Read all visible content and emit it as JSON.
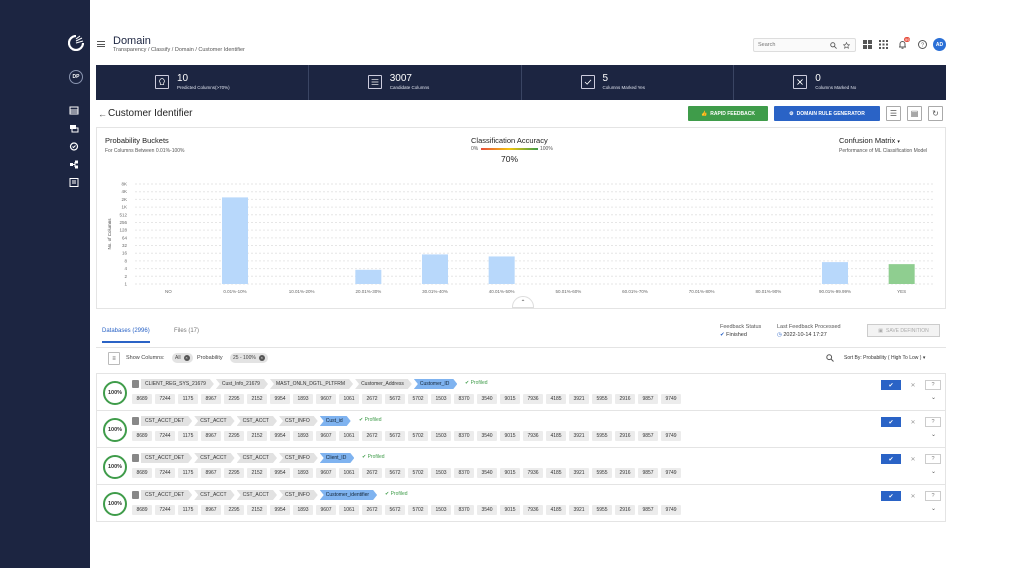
{
  "header": {
    "title": "Domain",
    "breadcrumb": "Transparency  /  Classify  /  Domain  /  Customer Identifier",
    "search_placeholder": "Search",
    "notification_count": "99",
    "avatar": "AD"
  },
  "sidebar": {
    "badge": "DP"
  },
  "stats": [
    {
      "value": "10",
      "label": "Predicted Columns(>70%)",
      "icon": "bulb-icon"
    },
    {
      "value": "3007",
      "label": "Candidate Columns",
      "icon": "table-icon"
    },
    {
      "value": "5",
      "label": "Columns Marked Yes",
      "icon": "check-icon"
    },
    {
      "value": "0",
      "label": "Columns Marked No",
      "icon": "close-icon"
    }
  ],
  "page": {
    "title": "Customer Identifier",
    "rapid_feedback": "RAPID FEEDBACK",
    "rule_generator": "DOMAIN RULE GENERATOR"
  },
  "panel": {
    "prob_title": "Probability Buckets",
    "prob_sub": "For Columns Between 0.01%-100%",
    "acc_title": "Classification Accuracy",
    "acc_min": "0%",
    "acc_max": "100%",
    "acc_value": "70%",
    "cm_title": "Confusion Matrix",
    "cm_sub": "Performance of ML Classification Model"
  },
  "chart_data": {
    "type": "bar",
    "ylabel": "No. of Columns",
    "yticks": [
      "8K",
      "4K",
      "2K",
      "1K",
      "512",
      "256",
      "128",
      "64",
      "32",
      "16",
      "8",
      "4",
      "2",
      "1"
    ],
    "categories": [
      "NO",
      "0.01%-10%",
      "10.01%-20%",
      "20.01%-30%",
      "30.01%-40%",
      "40.01%-50%",
      "50.01%-60%",
      "60.01%-70%",
      "70.01%-80%",
      "80.01%-90%",
      "90.01%-99.99%",
      "YES"
    ],
    "values": [
      0,
      2048,
      0,
      3,
      12,
      10,
      0,
      0,
      0,
      0,
      6,
      5
    ],
    "log_scale": true,
    "colors": {
      "bar": "#b8d8fb",
      "yes": "#8fce90"
    },
    "grid": true
  },
  "tabs": [
    {
      "label": "Databases (2996)"
    },
    {
      "label": "Files (17)"
    }
  ],
  "feedback": {
    "status_label": "Feedback Status",
    "status_value": "Finished",
    "last_label": "Last Feedback Processed",
    "last_value": "2022-10-14 17:27",
    "save": "SAVE DEFINITION"
  },
  "filters": {
    "show_label": "Show Columns:",
    "show_chip": "All",
    "prob_label": "Probability",
    "prob_chip": "25 - 100%",
    "sort": "Sort By: Probability ( High To Low )"
  },
  "rows": [
    {
      "score": "100%",
      "path": [
        "CLIENT_REG_SYS_21679",
        "Cust_Info_21679",
        "MAST_ONLN_DGTL_PLTFRM",
        "Customer_Address",
        "Customer_ID"
      ],
      "status": "Profiled",
      "values": [
        "8689",
        "7244",
        "1175",
        "8967",
        "2295",
        "2152",
        "9954",
        "1893",
        "9607",
        "1061",
        "2672",
        "5672",
        "5702",
        "1503",
        "8370",
        "3540",
        "9015",
        "7936",
        "4185",
        "3921",
        "5955",
        "2916",
        "9857",
        "9749"
      ]
    },
    {
      "score": "100%",
      "path": [
        "CST_ACCT_DET",
        "CST_ACCT",
        "CST_ACCT",
        "CST_INFO",
        "Cust_id"
      ],
      "status": "Profiled",
      "values": [
        "8689",
        "7244",
        "1175",
        "8967",
        "2295",
        "2152",
        "9954",
        "1893",
        "9607",
        "1061",
        "2672",
        "5672",
        "5702",
        "1503",
        "8370",
        "3540",
        "9015",
        "7936",
        "4185",
        "3921",
        "5955",
        "2916",
        "9857",
        "9749"
      ]
    },
    {
      "score": "100%",
      "path": [
        "CST_ACCT_DET",
        "CST_ACCT",
        "CST_ACCT",
        "CST_INFO",
        "Client_ID"
      ],
      "status": "Profiled",
      "values": [
        "8689",
        "7244",
        "1175",
        "8967",
        "2295",
        "2152",
        "9954",
        "1893",
        "9607",
        "1061",
        "2672",
        "5672",
        "5702",
        "1503",
        "8370",
        "3540",
        "9015",
        "7936",
        "4185",
        "3921",
        "5955",
        "2916",
        "9857",
        "9749"
      ]
    },
    {
      "score": "100%",
      "path": [
        "CST_ACCT_DET",
        "CST_ACCT",
        "CST_ACCT",
        "CST_INFO",
        "Customer_identifier"
      ],
      "status": "Profiled",
      "values": [
        "8689",
        "7244",
        "1175",
        "8967",
        "2295",
        "2152",
        "9954",
        "1893",
        "9607",
        "1061",
        "2672",
        "5672",
        "5702",
        "1503",
        "8370",
        "3540",
        "9015",
        "7936",
        "4185",
        "3921",
        "5955",
        "2916",
        "9857",
        "9749"
      ]
    }
  ]
}
